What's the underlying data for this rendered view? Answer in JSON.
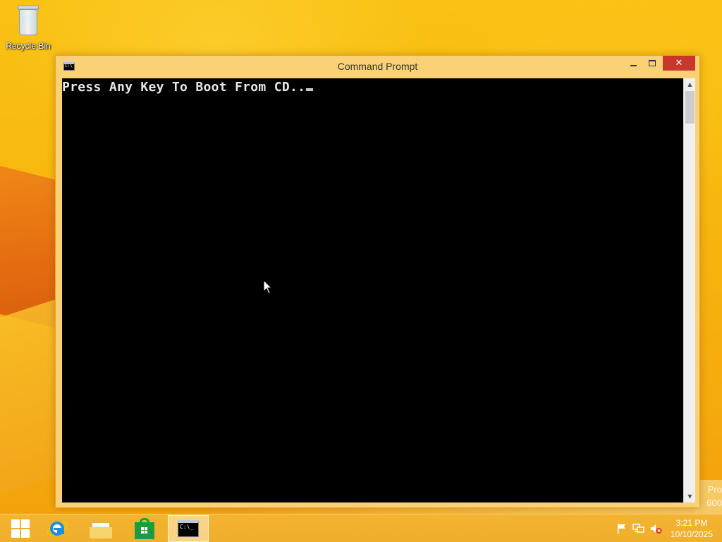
{
  "desktop": {
    "icons": [
      {
        "label": "Recycle Bin",
        "icon": "recycle-bin-icon"
      }
    ],
    "watermark_lines": [
      "Pro",
      "600"
    ]
  },
  "window": {
    "title": "Command Prompt",
    "app_icon": "cmd-icon",
    "app_icon_glyph": "C:\\",
    "controls": {
      "minimize": "minimize-icon",
      "maximize": "maximize-icon",
      "close": "close-icon",
      "close_glyph": "✕"
    },
    "console": {
      "text": "Press Any Key To Boot From CD..",
      "cursor": "block-cursor"
    },
    "scrollbar": {
      "up_glyph": "▲",
      "down_glyph": "▼"
    }
  },
  "taskbar": {
    "start": "windows-logo-icon",
    "pinned": [
      {
        "name": "Internet Explorer",
        "icon": "ie-icon"
      },
      {
        "name": "File Explorer",
        "icon": "folder-icon"
      },
      {
        "name": "Store",
        "icon": "store-icon"
      },
      {
        "name": "Command Prompt",
        "icon": "cmd-icon",
        "glyph": "C:\\_",
        "active": true
      }
    ],
    "tray": {
      "icons": [
        "flag-icon",
        "network-icon",
        "volume-muted-icon"
      ],
      "time": "3:21 PM",
      "date": "10/10/2025"
    }
  },
  "colors": {
    "wallpaper": "#f7b40d",
    "window_frame": "#fbd177",
    "close_button": "#c7372b",
    "console_bg": "#000000",
    "console_text": "#e8e8e8",
    "taskbar": "#f0b02c"
  }
}
